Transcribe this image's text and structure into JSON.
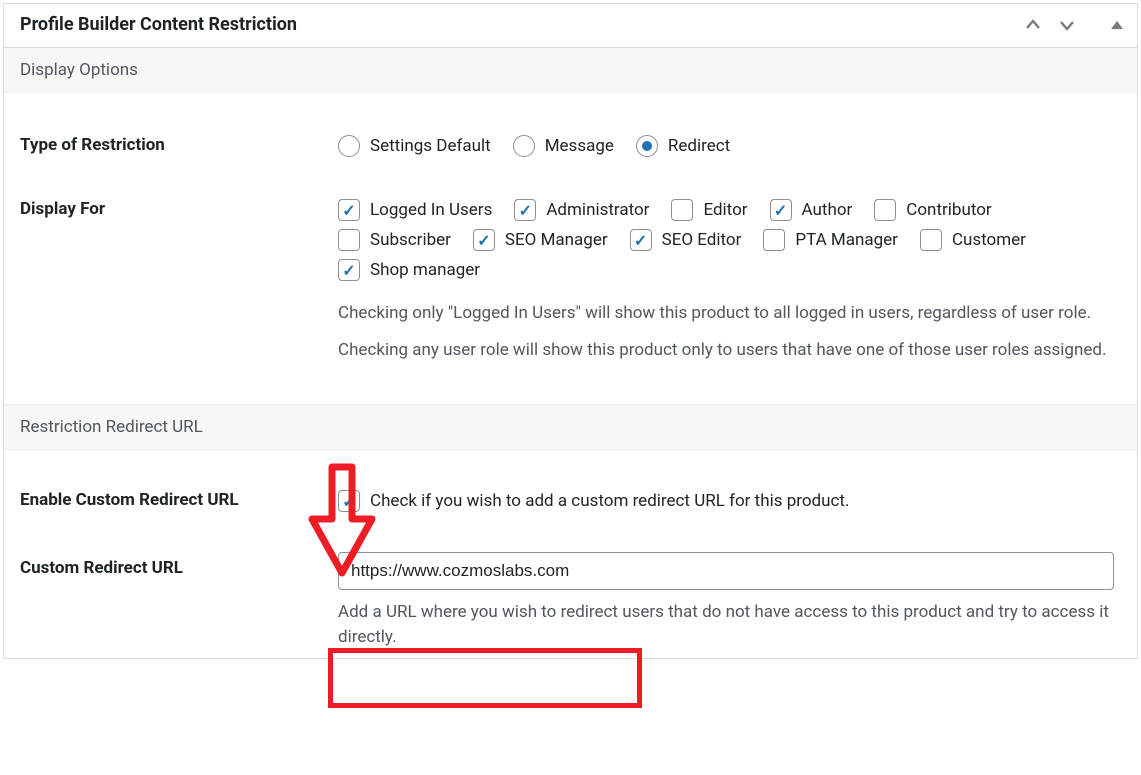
{
  "header": {
    "title": "Profile Builder Content Restriction"
  },
  "sections": {
    "displayOptions": {
      "title": "Display Options",
      "fields": {
        "typeOfRestriction": {
          "label": "Type of Restriction",
          "options": [
            {
              "label": "Settings Default",
              "checked": false
            },
            {
              "label": "Message",
              "checked": false
            },
            {
              "label": "Redirect",
              "checked": true
            }
          ]
        },
        "displayFor": {
          "label": "Display For",
          "options": [
            {
              "label": "Logged In Users",
              "checked": true
            },
            {
              "label": "Administrator",
              "checked": true
            },
            {
              "label": "Editor",
              "checked": false
            },
            {
              "label": "Author",
              "checked": true
            },
            {
              "label": "Contributor",
              "checked": false
            },
            {
              "label": "Subscriber",
              "checked": false
            },
            {
              "label": "SEO Manager",
              "checked": true
            },
            {
              "label": "SEO Editor",
              "checked": true
            },
            {
              "label": "PTA Manager",
              "checked": false
            },
            {
              "label": "Customer",
              "checked": false
            },
            {
              "label": "Shop manager",
              "checked": true
            }
          ],
          "help1": "Checking only \"Logged In Users\" will show this product to all logged in users, regardless of user role.",
          "help2": "Checking any user role will show this product only to users that have one of those user roles assigned."
        }
      }
    },
    "restrictionRedirect": {
      "title": "Restriction Redirect URL",
      "fields": {
        "enable": {
          "label": "Enable Custom Redirect URL",
          "checked": true,
          "help": "Check if you wish to add a custom redirect URL for this product."
        },
        "url": {
          "label": "Custom Redirect URL",
          "value": "https://www.cozmoslabs.com",
          "help": "Add a URL where you wish to redirect users that do not have access to this product and try to access it directly."
        }
      }
    }
  }
}
